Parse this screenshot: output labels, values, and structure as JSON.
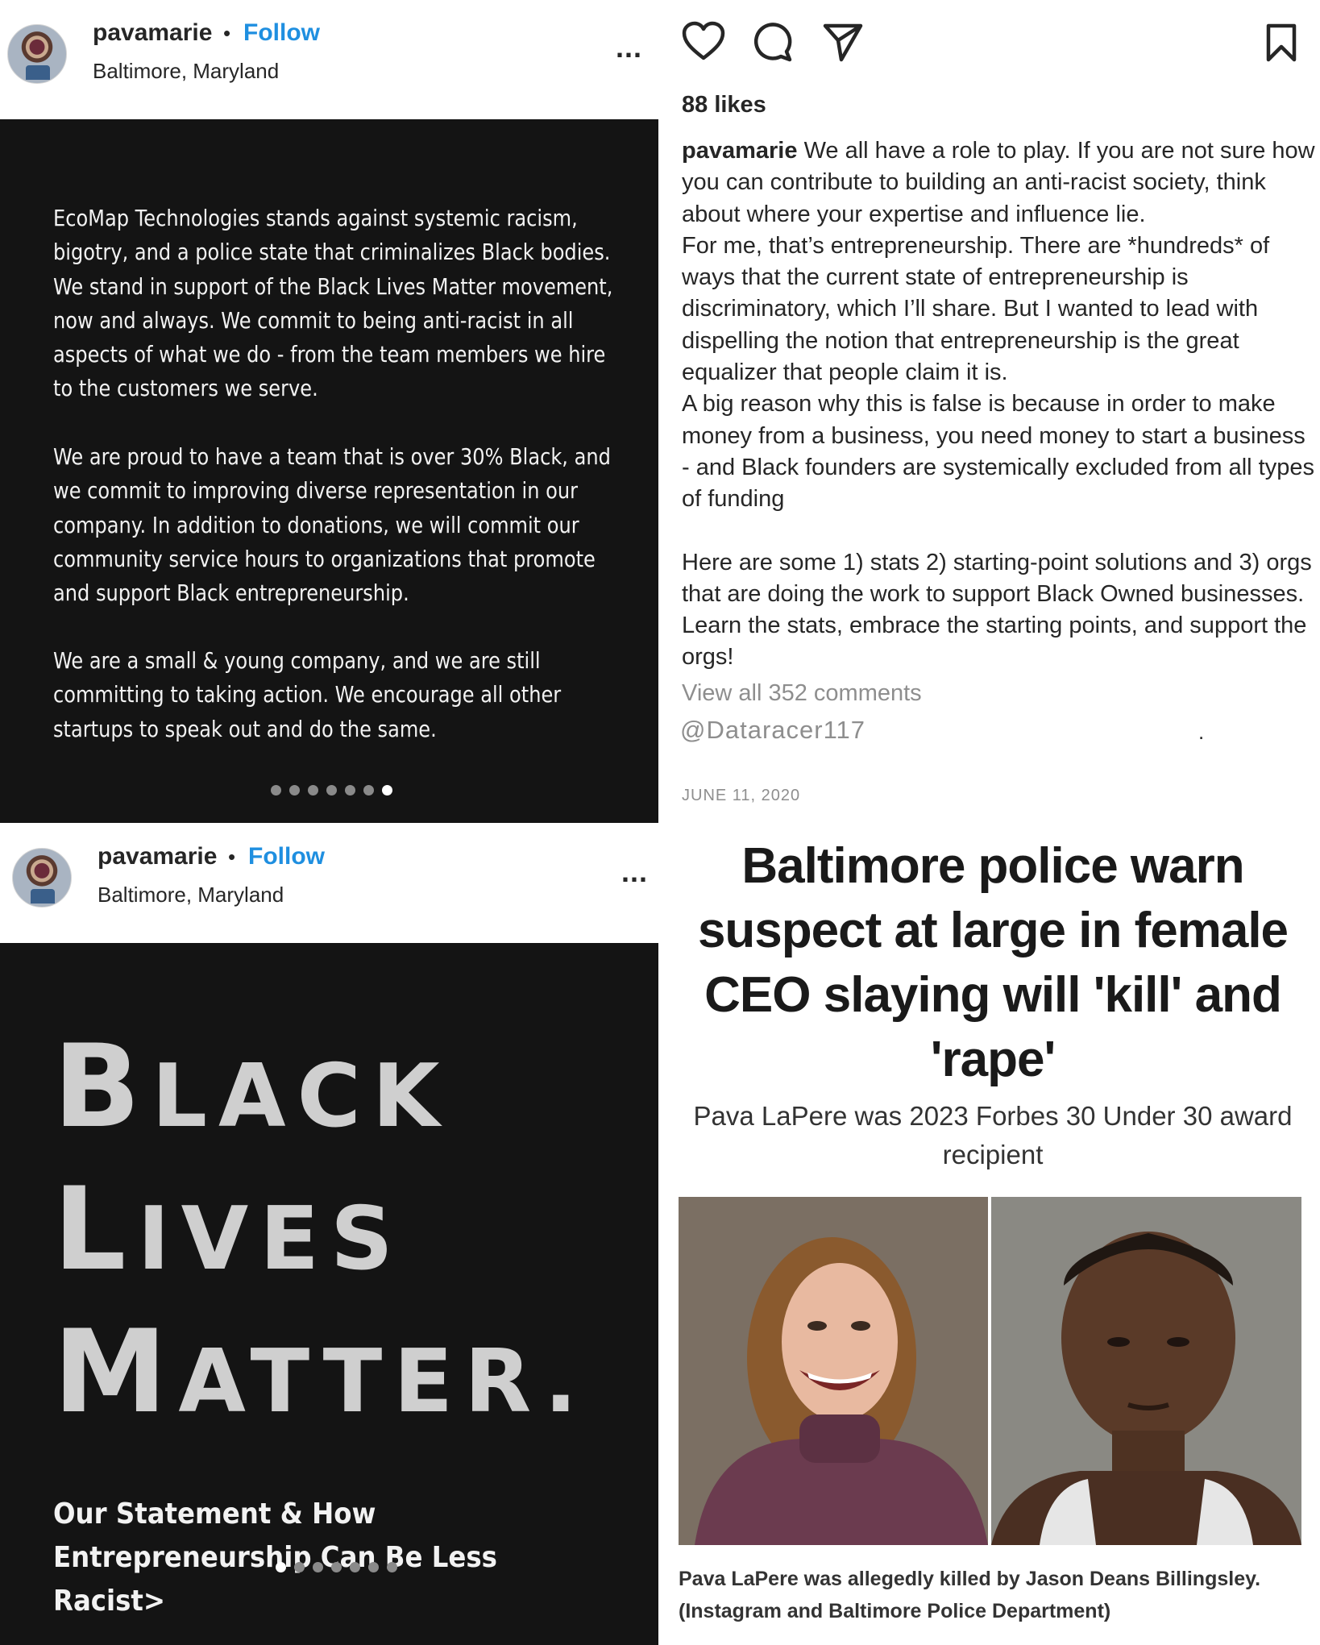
{
  "post_top": {
    "username": "pavamarie",
    "separator": "•",
    "follow_label": "Follow",
    "location": "Baltimore, Maryland",
    "more_label": "...",
    "statement_paragraphs": [
      "EcoMap Technologies stands against systemic racism, bigotry, and a police state that criminalizes Black bodies. We stand in support of the Black Lives Matter movement, now and always. We commit to being anti-racist in all aspects of what we do - from the team members we hire to the customers we serve.",
      "We are proud to have a team that is over 30% Black, and we commit to improving diverse representation in our company. In addition to donations, we will commit our community service hours to organizations that promote and support Black entrepreneurship.",
      "We are a small & young company, and we are still committing to taking action. We encourage all other startups to speak out and do the same."
    ],
    "carousel": {
      "total": 7,
      "active_index": 6
    }
  },
  "post_bottom": {
    "username": "pavamarie",
    "separator": "•",
    "follow_label": "Follow",
    "location": "Baltimore, Maryland",
    "more_label": "...",
    "blm_lines": [
      {
        "first": "B",
        "rest": "LACK"
      },
      {
        "first": "L",
        "rest": "IVES"
      },
      {
        "first": "M",
        "rest": "ATTER."
      }
    ],
    "subtitle": "Our Statement & How Entrepreneurship Can Be Less Racist>",
    "carousel": {
      "total": 7,
      "active_index": 0
    }
  },
  "post_details": {
    "icons": [
      "heart-icon",
      "comment-icon",
      "share-icon",
      "bookmark-icon"
    ],
    "likes": "88 likes",
    "caption_username": "pavamarie",
    "caption_lines": [
      "We all have a role to play. If you are not sure how you can contribute to building an anti-racist society, think about where your expertise and influence lie.",
      "For me, that’s entrepreneurship. There are *hundreds* of ways that the current state of entrepreneurship is discriminatory, which I’ll share. But I wanted to lead with dispelling the notion that entrepreneurship is the great equalizer that people claim it is.",
      "A big reason why this is false is because in order to make money from a business, you need money to start a business - and Black founders are systemically excluded from all types of funding",
      "Here are some 1) stats 2) starting-point solutions and 3) orgs that are doing the work to support Black Owned businesses. Learn the stats, embrace the starting points, and support the orgs!"
    ],
    "view_comments": "View all 352 comments",
    "handle": "@Dataracer117",
    "stray_mark": ".",
    "date": "JUNE 11, 2020"
  },
  "news": {
    "headline": "Baltimore police warn suspect at large in female CEO slaying will 'kill' and 'rape'",
    "subheadline": "Pava LaPere was 2023 Forbes 30 Under 30 award recipient",
    "photo_caption": "Pava LaPere was allegedly killed by Jason Deans Billingsley. (Instagram and Baltimore Police Department)"
  }
}
